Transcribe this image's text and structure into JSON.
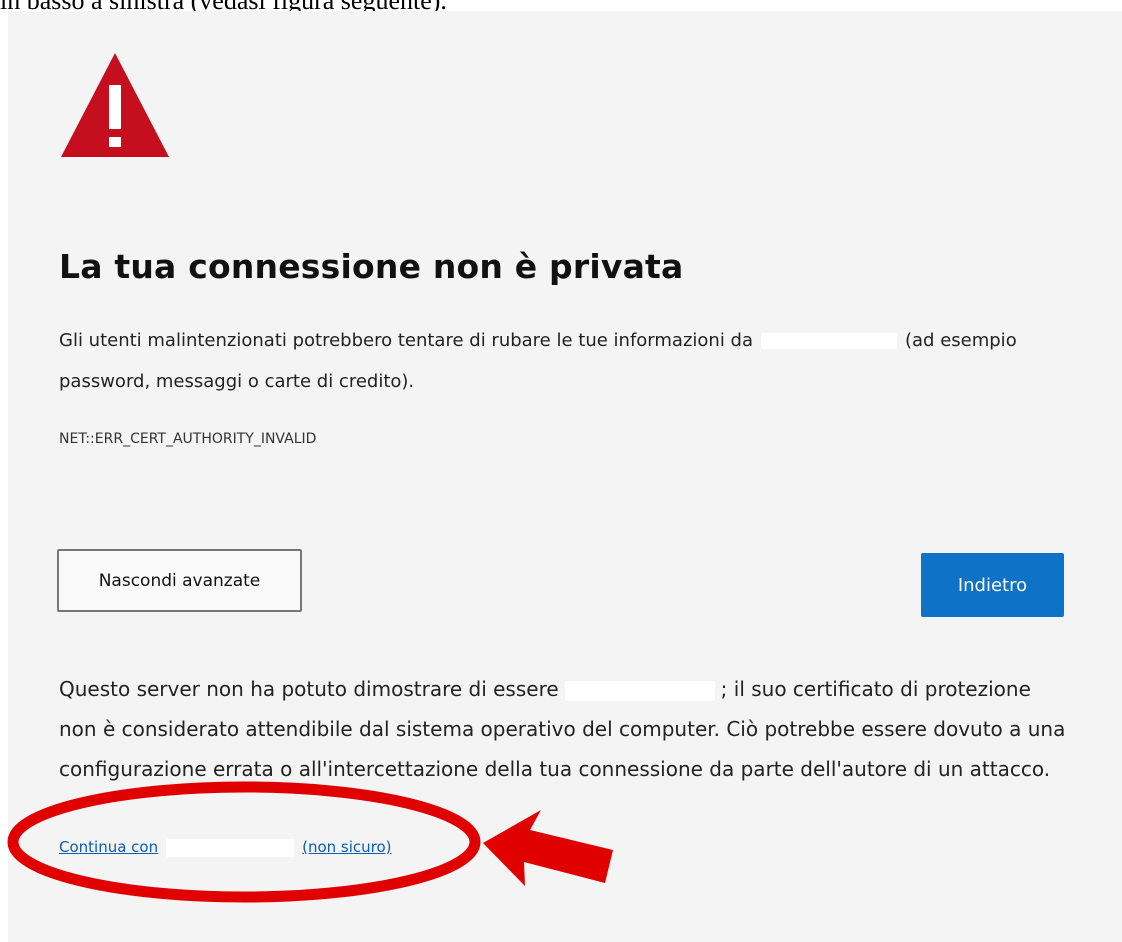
{
  "document": {
    "caption_fragment": "in basso a sinistra (vedasi figura seguente)."
  },
  "page": {
    "title": "La tua connessione non è privata",
    "intro_before": "Gli utenti malintenzionati potrebbero tentare di rubare le tue informazioni da",
    "intro_after": "(ad esempio password, messaggi o carte di credito).",
    "error_code": "NET::ERR_CERT_AUTHORITY_INVALID",
    "details_before": "Questo server non ha potuto dimostrare di essere",
    "details_after": "; il suo certificato di protezione non è considerato attendibile dal sistema operativo del computer. Ciò potrebbe essere dovuto a una configurazione errata o all'intercettazione della tua connessione da parte dell'autore di un attacco.",
    "continue_before": "Continua con",
    "continue_after": "(non sicuro)"
  },
  "buttons": {
    "hide_advanced": "Nascondi avanzate",
    "back": "Indietro"
  },
  "icons": {
    "warning": "warning-triangle-icon"
  },
  "colors": {
    "warning_red": "#c50f1f",
    "primary_blue": "#0e73c7",
    "link_blue": "#0b5db7",
    "annotation_red": "#e00000"
  }
}
